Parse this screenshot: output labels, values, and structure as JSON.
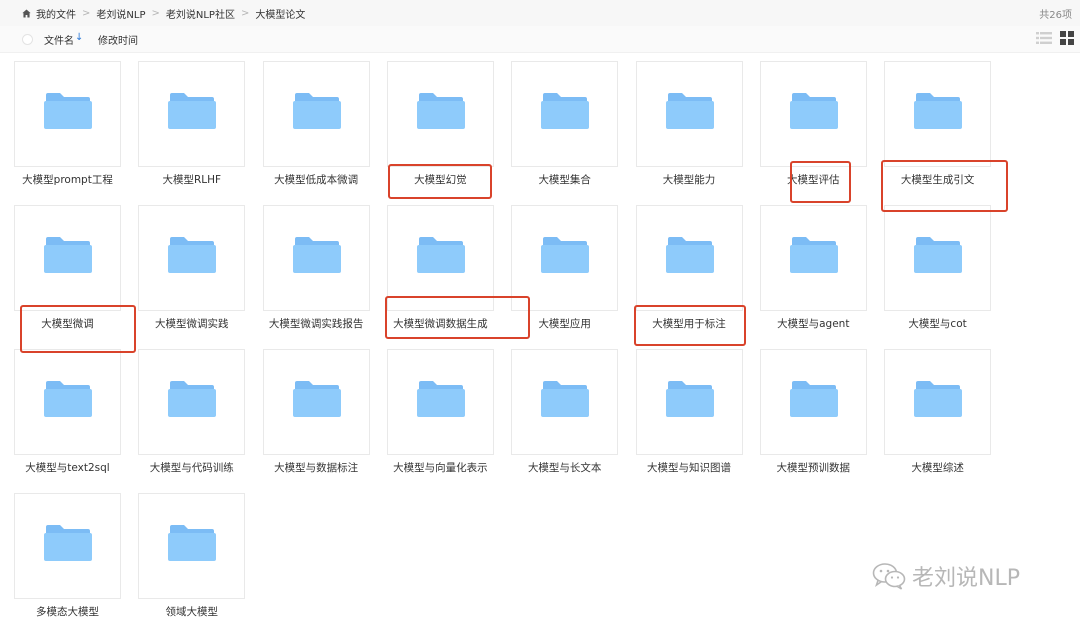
{
  "breadcrumb": [
    "我的文件",
    "老刘说NLP",
    "老刘说NLP社区",
    "大模型论文"
  ],
  "breadcrumb_separator": ">",
  "item_count": "共26项",
  "sort": {
    "name_label": "文件名",
    "arrow": "↓",
    "time_label": "修改时间"
  },
  "folders": [
    "大模型prompt工程",
    "大模型RLHF",
    "大模型低成本微调",
    "大模型幻觉",
    "大模型集合",
    "大模型能力",
    "大模型评估",
    "大模型生成引文",
    "大模型微调",
    "大模型微调实践",
    "大模型微调实践报告",
    "大模型微调数据生成",
    "大模型应用",
    "大模型用于标注",
    "大模型与agent",
    "大模型与cot",
    "大模型与text2sql",
    "大模型与代码训练",
    "大模型与数据标注",
    "大模型与向量化表示",
    "大模型与长文本",
    "大模型与知识图谱",
    "大模型预训数据",
    "大模型综述",
    "多模态大模型",
    "领域大模型"
  ],
  "highlighted_folders": [
    "大模型幻觉",
    "大模型评估",
    "大模型生成引文",
    "大模型微调",
    "大模型微调数据生成",
    "大模型用于标注"
  ],
  "watermark": "老刘说NLP",
  "colors": {
    "folder_back": "#7cbcf5",
    "folder_front": "#8ecbfb",
    "highlight": "#d9432b",
    "accent": "#2f7bd8"
  }
}
